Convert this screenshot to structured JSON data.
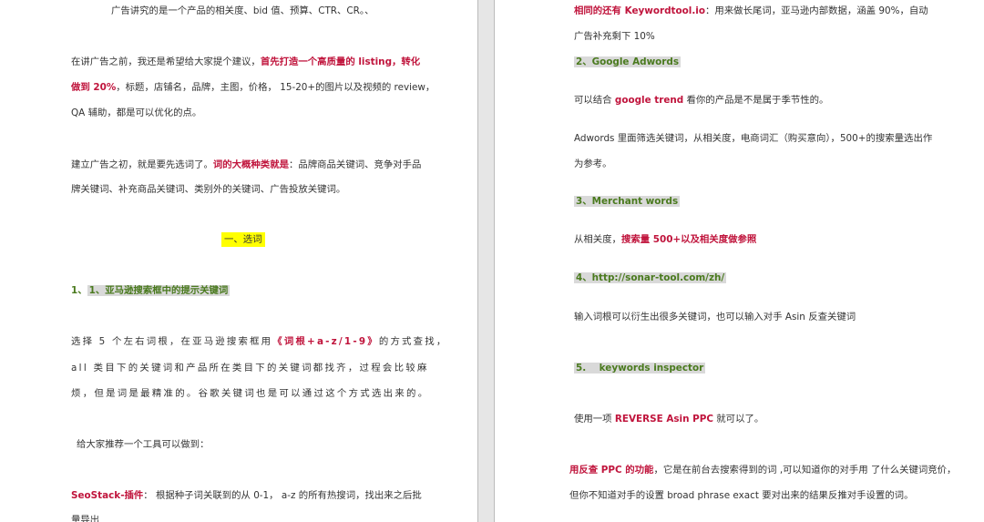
{
  "left": {
    "l1": "广告讲究的是一个产品的相关度、bid 值、预算、CTR、CR。、",
    "p1a_pre": "在讲广告之前，我还是希望给大家提个建议，",
    "p1a_red": "首先打造一个高质量的 listing，转化",
    "p1b_red": "做到 20%",
    "p1b_rest": "，标题，店铺名，品牌，主图，价格，  15-20+的图片以及视频的 review，",
    "p1c": "QA 辅助，都是可以优化的点。",
    "p2a_pre": "建立广告之初，就是要先选词了。",
    "p2a_red": "词的大概种类就是",
    "p2a_rest": "：品牌商品关键词、竞争对手品",
    "p2b": "牌关键词、补充商品关键词、类别外的关键词、广告投放关键词。",
    "section": "一、选词",
    "h1": "1、亚马逊搜索框中的提示关键词",
    "p3a_pre": "选择 5 个左右词根，在亚马逊搜索框用",
    "p3a_red": "《词根+a-z/1-9》",
    "p3a_rest": "的方式查找，",
    "p3b": "all 类目下的关键词和产品所在类目下的关键词都找齐，过程会比较麻",
    "p3c": "烦，但是词是最精准的。谷歌关键词也是可以通过这个方式选出来的。",
    "p4": "给大家推荐一个工具可以做到：",
    "p5a_red": "SeoStack-插件",
    "p5a_rest": "：  根据种子词关联到的从 0-1，  a-z 的所有热搜词，找出来之后批",
    "p5b": "量导出"
  },
  "right": {
    "r1_red": "相同的还有 Keywordtool.io",
    "r1_rest": "：用来做长尾词，亚马逊内部数据，涵盖 90%，自动",
    "r2": "广告补充剩下 10%",
    "h2": "2、Google Adwords",
    "r3_pre": "可以结合 ",
    "r3_red": "google trend",
    "r3_rest": " 看你的产品是不是属于季节性的。",
    "r4": "Adwords 里面筛选关键词，从相关度，电商词汇（购买意向），500+的搜索量选出作",
    "r5": "为参考。",
    "h3": "3、Merchant words",
    "r6_pre": "从相关度，",
    "r6_red": "搜索量 500+以及相关度做参照",
    "h4": "4、http://sonar-tool.com/zh/",
    "r7": "输入词根可以衍生出很多关键词，也可以输入对手 Asin 反查关键词",
    "h5": "5.    keywords inspector",
    "r8_pre": "使用一项 ",
    "r8_red": "REVERSE Asin PPC",
    "r8_rest": " 就可以了。",
    "r9_red": "用反查 PPC 的功能",
    "r9_rest": "，它是在前台去搜索得到的词 ,可以知道你的对手用  了什么关键词竞价，",
    "r10": "但你不知道对手的设置 broad phrase exact  要对出来的结果反推对手设置的词。"
  },
  "colors": {
    "red_text": "#c0143c",
    "heading_green": "#4a7a1e",
    "heading_bg": "#d9d9d9",
    "highlight_yellow": "#ffff00"
  }
}
